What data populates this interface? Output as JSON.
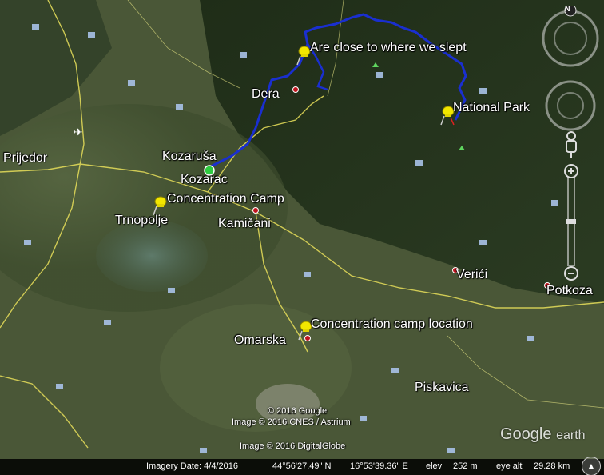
{
  "app": {
    "name": "Google Earth"
  },
  "places": [
    {
      "id": "prijedor",
      "label": "Prijedor"
    },
    {
      "id": "kozarusa",
      "label": "Kozaruša"
    },
    {
      "id": "kozarac",
      "label": "Kozarac"
    },
    {
      "id": "trnopolje",
      "label": "Trnopolje"
    },
    {
      "id": "kamicani",
      "label": "Kamičani"
    },
    {
      "id": "dera",
      "label": "Dera"
    },
    {
      "id": "verici",
      "label": "Verići"
    },
    {
      "id": "potkozarje",
      "label": "Potkoza"
    },
    {
      "id": "omarska",
      "label": "Omarska"
    },
    {
      "id": "piskavica",
      "label": "Piskavica"
    }
  ],
  "placemarks": [
    {
      "id": "slept",
      "label": "Are close to where we slept",
      "color": "#f2e600"
    },
    {
      "id": "national-park",
      "label": "National Park",
      "color": "#f2e600"
    },
    {
      "id": "camp-trnopolje",
      "label": "Concentration Camp",
      "color": "#f2e600"
    },
    {
      "id": "camp-omarska",
      "label": "Concentration camp location",
      "color": "#f2e600"
    }
  ],
  "track": {
    "color": "#1a2fd0"
  },
  "credits": {
    "line1": "© 2016 Google",
    "line2": "Image © 2016 CNES / Astrium",
    "line3": "Image © 2016 DigitalGlobe"
  },
  "logo": {
    "google": "Google",
    "earth": "earth"
  },
  "status": {
    "imagery_date": "Imagery Date: 4/4/2016",
    "lat": "44°56'27.49\" N",
    "lon": "16°53'39.36\" E",
    "elev_label": "elev",
    "elev_value": "252 m",
    "eye_label": "eye alt",
    "eye_value": "29.28 km"
  },
  "nav": {
    "north": "N"
  },
  "colors": {
    "road": "#e8df5a",
    "border_road": "#f4f08a",
    "forest": "#2a3b1f",
    "plain": "#4f5d3a"
  }
}
